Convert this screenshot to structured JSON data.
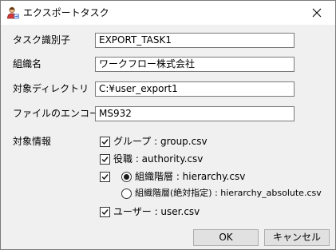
{
  "window": {
    "title": "エクスポートタスク",
    "icons": {
      "app": "user-export-icon",
      "close": "close-icon"
    }
  },
  "fields": {
    "task_id": {
      "label": "タスク識別子",
      "value": "EXPORT_TASK1"
    },
    "org_name": {
      "label": "組織名",
      "value": "ワークフロー株式会社"
    },
    "target_dir": {
      "label": "対象ディレクトリ",
      "value": "C:¥user_export1"
    },
    "encoding": {
      "label": "ファイルのエンコード",
      "value": "MS932"
    }
  },
  "targets": {
    "label": "対象情報",
    "group": {
      "label": "グループ : group.csv",
      "checked": true
    },
    "authority": {
      "label": "役職 : authority.csv",
      "checked": true
    },
    "hierarchy": {
      "checked": true
    },
    "hierarchy_option": {
      "label": "組織階層 : hierarchy.csv",
      "selected": true
    },
    "hierarchy_absolute_option": {
      "label": "組織階層(絶対指定) : hierarchy_absolute.csv",
      "selected": false
    },
    "user": {
      "label": "ユーザー : user.csv",
      "checked": true
    }
  },
  "buttons": {
    "ok": "OK",
    "cancel": "キャンセル"
  }
}
